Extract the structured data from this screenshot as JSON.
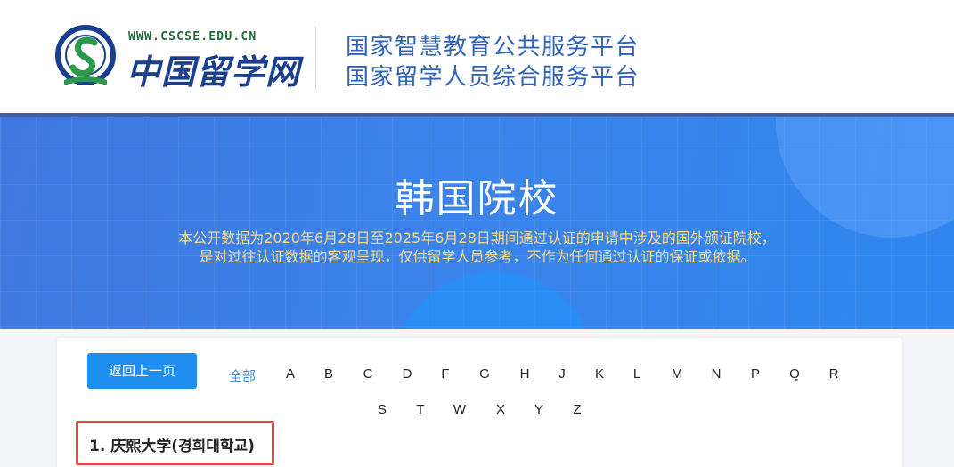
{
  "header": {
    "logo_url": "WWW.CSCSE.EDU.CN",
    "logo_name": "中国留学网",
    "platform_line1": "国家智慧教育公共服务平台",
    "platform_line2": "国家留学人员综合服务平台"
  },
  "banner": {
    "title": "韩国院校",
    "desc_line1": "本公开数据为2020年6月28日至2025年6月28日期间通过认证的申请中涉及的国外颁证院校，",
    "desc_line2": "是对过往认证数据的客观呈现，仅供留学人员参考，不作为任何通过认证的保证或依据。"
  },
  "nav": {
    "back_label": "返回上一页",
    "all_label": "全部",
    "letters": [
      "A",
      "B",
      "C",
      "D",
      "F",
      "G",
      "H",
      "J",
      "K",
      "L",
      "M",
      "N",
      "P",
      "Q",
      "R",
      "S",
      "T",
      "W",
      "X",
      "Y",
      "Z"
    ]
  },
  "list": {
    "items": [
      {
        "label": "1.  庆熙大学(경희대학교)"
      }
    ]
  },
  "colors": {
    "accent": "#1f8ef1",
    "banner_blue": "#3b83ea",
    "desc_yellow": "#f6dc8b",
    "highlight_red": "#e34b4b"
  }
}
